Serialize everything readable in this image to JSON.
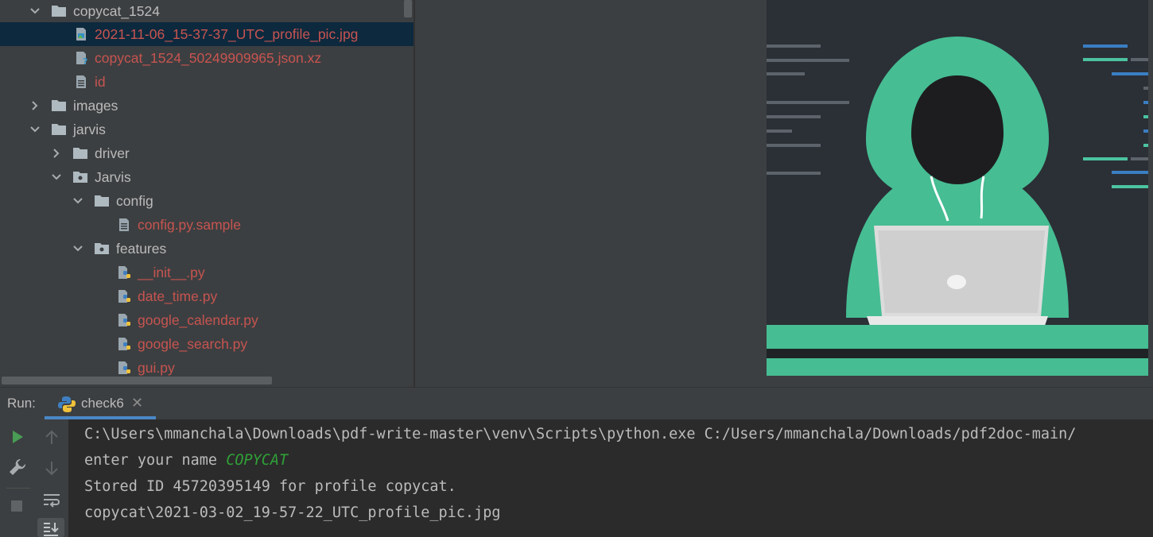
{
  "project_tree": {
    "items": [
      {
        "label": "copycat_1524"
      },
      {
        "label": "2021-11-06_15-37-37_UTC_profile_pic.jpg"
      },
      {
        "label": "copycat_1524_50249909965.json.xz"
      },
      {
        "label": "id"
      },
      {
        "label": "images"
      },
      {
        "label": "jarvis"
      },
      {
        "label": "driver"
      },
      {
        "label": "Jarvis"
      },
      {
        "label": "config"
      },
      {
        "label": "config.py.sample"
      },
      {
        "label": "features"
      },
      {
        "label": "__init__.py"
      },
      {
        "label": "date_time.py"
      },
      {
        "label": "google_calendar.py"
      },
      {
        "label": "google_search.py"
      },
      {
        "label": "gui.py"
      }
    ]
  },
  "run_panel": {
    "label": "Run:",
    "tab_label": "check6",
    "console": {
      "line1": "C:\\Users\\mmanchala\\Downloads\\pdf-write-master\\venv\\Scripts\\python.exe C:/Users/mmanchala/Downloads/pdf2doc-main/",
      "line2_prompt": "enter your name ",
      "line2_input": "COPYCAT",
      "line3": "Stored ID 45720395149 for profile copycat.",
      "line4": "copycat\\2021-03-02_19-57-22_UTC_profile_pic.jpg"
    }
  },
  "colors": {
    "vcs_unversioned": "#c75450",
    "console_input": "#2fa037",
    "hoodie": "#46bd93",
    "selection": "#0d293e"
  }
}
